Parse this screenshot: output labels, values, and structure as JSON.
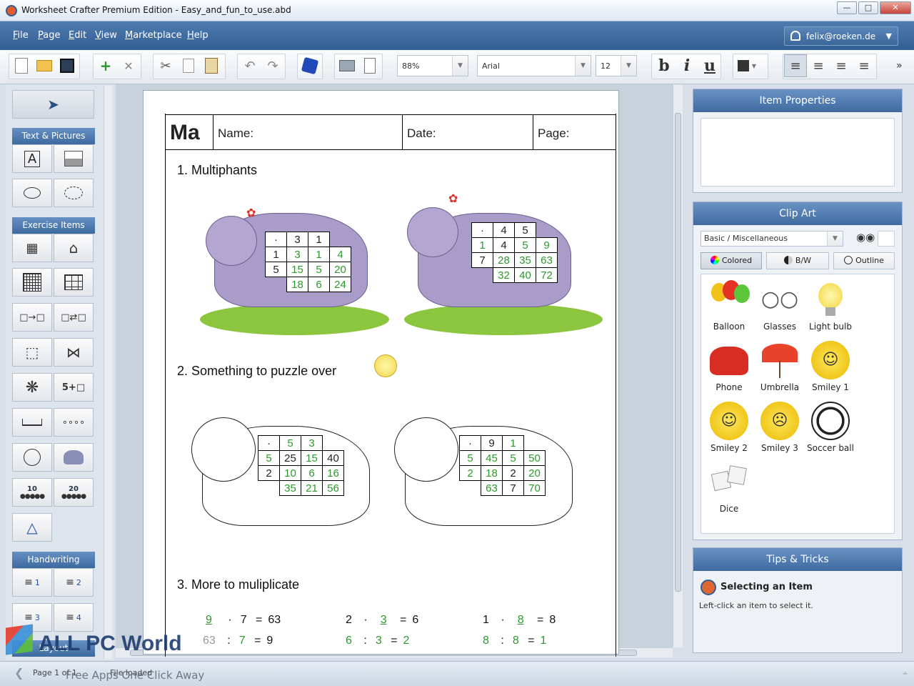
{
  "window": {
    "title": "Worksheet Crafter Premium Edition - Easy_and_fun_to_use.abd"
  },
  "menu": [
    {
      "label": "File",
      "u": "F",
      "rest": "ile"
    },
    {
      "label": "Page",
      "u": "P",
      "rest": "age"
    },
    {
      "label": "Edit",
      "u": "E",
      "rest": "dit"
    },
    {
      "label": "View",
      "u": "V",
      "rest": "iew"
    },
    {
      "label": "Marketplace",
      "u": "M",
      "rest": "arketplace"
    },
    {
      "label": "Help",
      "u": "H",
      "rest": "elp"
    }
  ],
  "user": {
    "email": "felix@roeken.de"
  },
  "toolbar": {
    "zoom": "88%",
    "font": "Arial",
    "size": "12",
    "bold": "b",
    "italic": "i",
    "underline": "u"
  },
  "palette": {
    "text_pictures": "Text & Pictures",
    "exercise_items": "Exercise Items",
    "handwriting": "Handwriting",
    "layout": "Layout",
    "count10": "10",
    "count20": "20",
    "formula": "5+□",
    "hw1": "1",
    "hw2": "2",
    "hw3": "3",
    "hw4": "4"
  },
  "worksheet": {
    "logo": "Ma",
    "name": "Name:",
    "date": "Date:",
    "page": "Page:",
    "q1": "1. Multiphants",
    "q2": "2. Something to puzzle over",
    "q3": "3. More to muliplicate",
    "grid1": [
      [
        "·",
        "3",
        "1"
      ],
      [
        "1",
        "3",
        "1",
        "4"
      ],
      [
        "5",
        "15",
        "5",
        "20"
      ],
      [
        "",
        "18",
        "6",
        "24"
      ]
    ],
    "grid2": [
      [
        "·",
        "4",
        "5"
      ],
      [
        "1",
        "4",
        "5",
        "9"
      ],
      [
        "7",
        "28",
        "35",
        "63"
      ],
      [
        "",
        "32",
        "40",
        "72"
      ]
    ],
    "grid3": [
      [
        "·",
        "5",
        "3"
      ],
      [
        "5",
        "25",
        "15",
        "40"
      ],
      [
        "2",
        "10",
        "6",
        "16"
      ],
      [
        "",
        "35",
        "21",
        "56"
      ]
    ],
    "grid4": [
      [
        "·",
        "9",
        "1"
      ],
      [
        "5",
        "45",
        "5",
        "50"
      ],
      [
        "2",
        "18",
        "2",
        "20"
      ],
      [
        "",
        "63",
        "7",
        "70"
      ]
    ],
    "eq_row1": [
      {
        "a": "9",
        "op": "·",
        "b": "7",
        "c": "63"
      },
      {
        "a": "2",
        "op": "·",
        "b": "3",
        "c": "6"
      },
      {
        "a": "1",
        "op": "·",
        "b": "8",
        "c": "8"
      }
    ],
    "eq_row2": [
      {
        "a": "63",
        "op": ":",
        "b": "7",
        "c": "9"
      },
      {
        "a": "6",
        "op": ":",
        "b": "3",
        "c": "2"
      },
      {
        "a": "8",
        "op": ":",
        "b": "8",
        "c": "1"
      }
    ],
    "eq_sign": "="
  },
  "item_properties": {
    "title": "Item Properties"
  },
  "clip_art": {
    "title": "Clip Art",
    "category": "Basic / Miscellaneous",
    "modes": [
      "Colored",
      "B/W",
      "Outline"
    ],
    "items": [
      "Balloon",
      "Glasses",
      "Light bulb",
      "Phone",
      "Umbrella",
      "Smiley 1",
      "Smiley 2",
      "Smiley 3",
      "Soccer ball",
      "Dice"
    ]
  },
  "tips": {
    "title": "Tips & Tricks",
    "heading": "Selecting an Item",
    "body": "Left-click an item to select it."
  },
  "status": {
    "page": "Page 1 of 1",
    "msg": "File loaded"
  },
  "watermark": {
    "brand": "ALL PC World",
    "tagline": "Free Apps One Click Away"
  },
  "colors": {
    "accent": "#3f6aa0",
    "green": "#2a9a2a"
  }
}
